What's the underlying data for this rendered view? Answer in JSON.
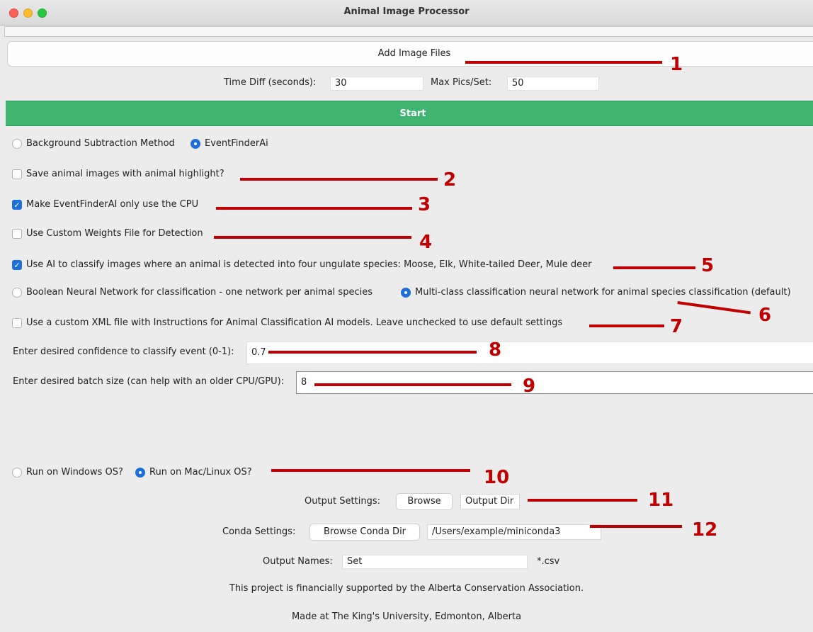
{
  "window": {
    "title": "Animal Image Processor"
  },
  "add_files": {
    "label": "Add Image Files"
  },
  "params": {
    "time_diff_label": "Time Diff (seconds):",
    "time_diff_value": "30",
    "max_pics_label": "Max Pics/Set:",
    "max_pics_value": "50"
  },
  "start": {
    "label": "Start"
  },
  "method": {
    "option1": "Background Subtraction Method",
    "option2": "EventFinderAi"
  },
  "options": {
    "save_highlight": "Save animal images with animal highlight?",
    "cpu_only": "Make EventFinderAI only use the CPU",
    "custom_weights": "Use Custom Weights File for Detection",
    "classify": "Use AI to classify images where an animal is detected into four ungulate species: Moose, Elk, White-tailed Deer, Mule deer",
    "custom_xml": "Use a custom XML file with Instructions for Animal Classification AI models. Leave unchecked to use default settings"
  },
  "network": {
    "option1": "Boolean Neural Network for classification - one network per animal species",
    "option2": "Multi-class classification neural network for animal species classification  (default)"
  },
  "confidence": {
    "label": "Enter desired confidence to classify event (0-1):",
    "value": "0.7"
  },
  "batch": {
    "label": "Enter desired batch size (can help with an older CPU/GPU):",
    "value": "8"
  },
  "os": {
    "option1": "Run on Windows OS?",
    "option2": "Run on Mac/Linux OS?"
  },
  "output_settings": {
    "label": "Output Settings:",
    "browse": "Browse",
    "dir": "Output Dir"
  },
  "conda_settings": {
    "label": "Conda Settings:",
    "browse": "Browse Conda Dir",
    "path": "/Users/example/miniconda3"
  },
  "output_names": {
    "label": "Output Names:",
    "value": "Set",
    "suffix": "*.csv"
  },
  "footer": {
    "support": "This project is financially supported by the Alberta Conservation Association.",
    "made_at": "Made at The King's University, Edmonton, Alberta"
  },
  "annotations": {
    "a1": "1",
    "a2": "2",
    "a3": "3",
    "a4": "4",
    "a5": "5",
    "a6": "6",
    "a7": "7",
    "a8": "8",
    "a9": "9",
    "a10": "10",
    "a11": "11",
    "a12": "12"
  },
  "colors": {
    "start_bar": "#3fb470",
    "annotation": "#c00000",
    "accent": "#1e6fd9"
  }
}
